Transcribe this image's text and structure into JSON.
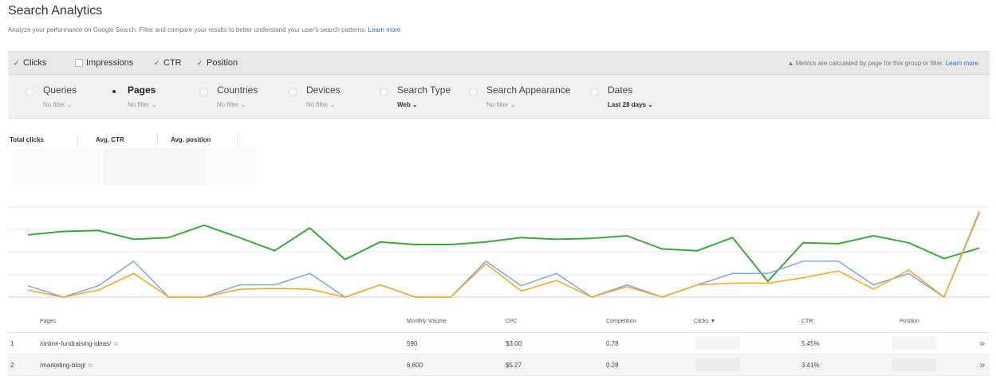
{
  "header": {
    "title": "Search Analytics",
    "subtitle": "Analyze your performance on Google Search. Filter and compare your results to better understand your user's search patterns.",
    "learn_more": "Learn more"
  },
  "metrics": [
    {
      "label": "Clicks",
      "checked": true
    },
    {
      "label": "Impressions",
      "checked": false
    },
    {
      "label": "CTR",
      "checked": true
    },
    {
      "label": "Position",
      "checked": true
    }
  ],
  "metrics_note": {
    "icon": "warning-icon",
    "text": "Metrics are calculated by page for this group or filter.",
    "link": "Learn more."
  },
  "dimensions": [
    {
      "label": "Queries",
      "filter": "No filter ⌄",
      "selected": false
    },
    {
      "label": "Pages",
      "filter": "No filter ⌄",
      "selected": true
    },
    {
      "label": "Countries",
      "filter": "No filter ⌄",
      "selected": false
    },
    {
      "label": "Devices",
      "filter": "No filter ⌄",
      "selected": false
    },
    {
      "label": "Search Type",
      "filter": "Web ⌄",
      "selected": false
    },
    {
      "label": "Search Appearance",
      "filter": "No filter ⌄",
      "selected": false
    },
    {
      "label": "Dates",
      "filter": "Last 28 days ⌄",
      "selected": false
    }
  ],
  "totals": {
    "total_clicks": "Total clicks",
    "avg_ctr": "Avg. CTR",
    "avg_position": "Avg. position"
  },
  "chart_data": {
    "type": "line",
    "x": [
      1,
      2,
      3,
      4,
      5,
      6,
      7,
      8,
      9,
      10,
      11,
      12,
      13,
      14,
      15,
      16,
      17,
      18,
      19,
      20,
      21,
      22,
      23,
      24,
      25,
      26,
      27,
      28
    ],
    "series": [
      {
        "name": "",
        "color": "#3aa83a",
        "values": [
          71,
          75,
          76,
          66,
          68,
          82,
          68,
          53,
          79,
          43,
          63,
          60,
          60,
          63,
          68,
          66,
          67,
          70,
          55,
          53,
          68,
          18,
          62,
          61,
          70,
          62,
          44,
          56
        ]
      },
      {
        "name": "",
        "color": "#7ea6e4",
        "values": [
          13,
          0,
          13,
          41,
          0,
          0,
          14,
          14,
          27,
          0,
          14,
          0,
          0,
          41,
          13,
          27,
          0,
          14,
          0,
          14,
          27,
          27,
          41,
          41,
          14,
          27,
          0,
          96
        ]
      },
      {
        "name": "",
        "color": "#f2a623",
        "values": [
          8,
          0,
          8,
          27,
          0,
          0,
          9,
          10,
          9,
          0,
          14,
          0,
          0,
          38,
          7,
          19,
          0,
          12,
          0,
          14,
          16,
          16,
          22,
          30,
          9,
          31,
          0,
          98
        ]
      }
    ]
  },
  "table": {
    "columns": [
      "Pages",
      "Monthly Volume",
      "CPC",
      "Competition",
      "Clicks ▼",
      "CTR",
      "Position"
    ],
    "rows": [
      {
        "num": "1",
        "page": "/online-fundraising-ideas/",
        "volume": "590",
        "cpc": "$3.00",
        "competition": "0.78",
        "ctr": "5.45%"
      },
      {
        "num": "2",
        "page": "/marketing-blog/",
        "volume": "6,600",
        "cpc": "$5.27",
        "competition": "0.28",
        "ctr": "3.41%"
      }
    ]
  }
}
